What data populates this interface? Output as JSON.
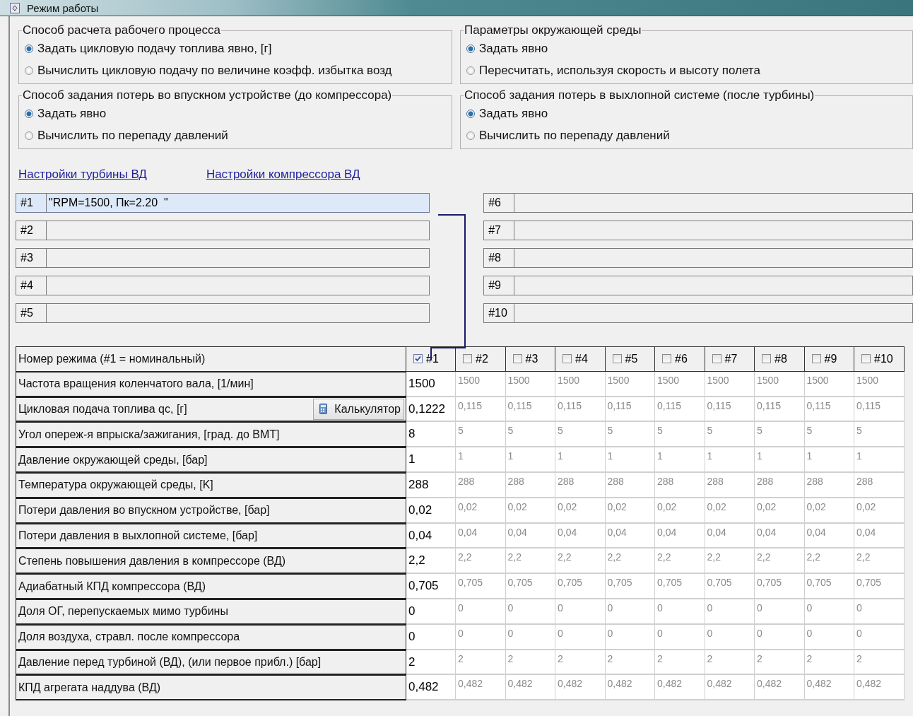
{
  "window": {
    "title": "Режим работы"
  },
  "groups": [
    {
      "title": "Способ расчета рабочего процесса",
      "options": [
        {
          "label": "Задать цикловую подачу топлива явно, [г]",
          "selected": true
        },
        {
          "label": "Вычислить цикловую подачу по величине коэфф. избытка возд",
          "selected": false
        }
      ]
    },
    {
      "title": "Параметры окружающей среды",
      "options": [
        {
          "label": "Задать явно",
          "selected": true
        },
        {
          "label": "Пересчитать, используя скорость и высоту полета",
          "selected": false
        }
      ]
    },
    {
      "title": "Способ задания потерь во впускном устройстве (до компрессора)",
      "options": [
        {
          "label": "Задать явно",
          "selected": true
        },
        {
          "label": "Вычислить по перепаду давлений",
          "selected": false
        }
      ]
    },
    {
      "title": "Способ задания потерь в выхлопной системе (после турбины)",
      "options": [
        {
          "label": "Задать явно",
          "selected": true
        },
        {
          "label": "Вычислить по перепаду давлений",
          "selected": false
        }
      ]
    }
  ],
  "links": [
    "Настройки турбины ВД",
    "Настройки компрессора ВД"
  ],
  "modes": [
    {
      "label": "#1",
      "value": "\"RPM=1500, Пк=2.20  \"",
      "selected": true
    },
    {
      "label": "#2",
      "selected": false
    },
    {
      "label": "#3",
      "selected": false
    },
    {
      "label": "#4",
      "selected": false
    },
    {
      "label": "#5",
      "selected": false
    },
    {
      "label": "#6",
      "selected": false
    },
    {
      "label": "#7",
      "selected": false
    },
    {
      "label": "#8",
      "selected": false
    },
    {
      "label": "#9",
      "selected": false
    },
    {
      "label": "#10",
      "selected": false
    }
  ],
  "table": {
    "header_label": "Номер режима (#1 = номинальный)",
    "columns": [
      {
        "label": "#1",
        "checked": true
      },
      {
        "label": "#2",
        "checked": false
      },
      {
        "label": "#3",
        "checked": false
      },
      {
        "label": "#4",
        "checked": false
      },
      {
        "label": "#5",
        "checked": false
      },
      {
        "label": "#6",
        "checked": false
      },
      {
        "label": "#7",
        "checked": false
      },
      {
        "label": "#8",
        "checked": false
      },
      {
        "label": "#9",
        "checked": false
      },
      {
        "label": "#10",
        "checked": false
      }
    ],
    "rows": [
      {
        "label": "Частота вращения коленчатого вала, [1/мин]",
        "values": [
          "1500",
          "1500",
          "1500",
          "1500",
          "1500",
          "1500",
          "1500",
          "1500",
          "1500",
          "1500"
        ]
      },
      {
        "label": "Цикловая подача топлива qc, [г]",
        "button": "Калькулятор",
        "values": [
          "0,1222",
          "0,115",
          "0,115",
          "0,115",
          "0,115",
          "0,115",
          "0,115",
          "0,115",
          "0,115",
          "0,115"
        ]
      },
      {
        "label": "Угол опереж-я впрыска/зажигания, [град. до ВМТ]",
        "values": [
          "8",
          "5",
          "5",
          "5",
          "5",
          "5",
          "5",
          "5",
          "5",
          "5"
        ]
      },
      {
        "label": "Давление окружающей среды, [бар]",
        "values": [
          "1",
          "1",
          "1",
          "1",
          "1",
          "1",
          "1",
          "1",
          "1",
          "1"
        ]
      },
      {
        "label": "Температура окружающей среды, [K]",
        "values": [
          "288",
          "288",
          "288",
          "288",
          "288",
          "288",
          "288",
          "288",
          "288",
          "288"
        ]
      },
      {
        "label": "Потери давления во впускном устройстве, [бар]",
        "values": [
          "0,02",
          "0,02",
          "0,02",
          "0,02",
          "0,02",
          "0,02",
          "0,02",
          "0,02",
          "0,02",
          "0,02"
        ]
      },
      {
        "label": "Потери давления в выхлопной системе, [бар]",
        "values": [
          "0,04",
          "0,04",
          "0,04",
          "0,04",
          "0,04",
          "0,04",
          "0,04",
          "0,04",
          "0,04",
          "0,04"
        ]
      },
      {
        "label": "Степень повышения давления в компрессоре (ВД)",
        "values": [
          "2,2",
          "2,2",
          "2,2",
          "2,2",
          "2,2",
          "2,2",
          "2,2",
          "2,2",
          "2,2",
          "2,2"
        ]
      },
      {
        "label": "Адиабатный КПД компрессора (ВД)",
        "values": [
          "0,705",
          "0,705",
          "0,705",
          "0,705",
          "0,705",
          "0,705",
          "0,705",
          "0,705",
          "0,705",
          "0,705"
        ]
      },
      {
        "label": "Доля ОГ, перепускаемых мимо турбины",
        "values": [
          "0",
          "0",
          "0",
          "0",
          "0",
          "0",
          "0",
          "0",
          "0",
          "0"
        ]
      },
      {
        "label": "Доля воздуха, стравл. после компрессора",
        "values": [
          "0",
          "0",
          "0",
          "0",
          "0",
          "0",
          "0",
          "0",
          "0",
          "0"
        ]
      },
      {
        "label": "Давление перед турбиной (ВД), (или первое прибл.) [бар]",
        "values": [
          "2",
          "2",
          "2",
          "2",
          "2",
          "2",
          "2",
          "2",
          "2",
          "2"
        ]
      },
      {
        "label": "КПД агрегата наддува (ВД)",
        "values": [
          "0,482",
          "0,482",
          "0,482",
          "0,482",
          "0,482",
          "0,482",
          "0,482",
          "0,482",
          "0,482",
          "0,482"
        ]
      }
    ]
  }
}
